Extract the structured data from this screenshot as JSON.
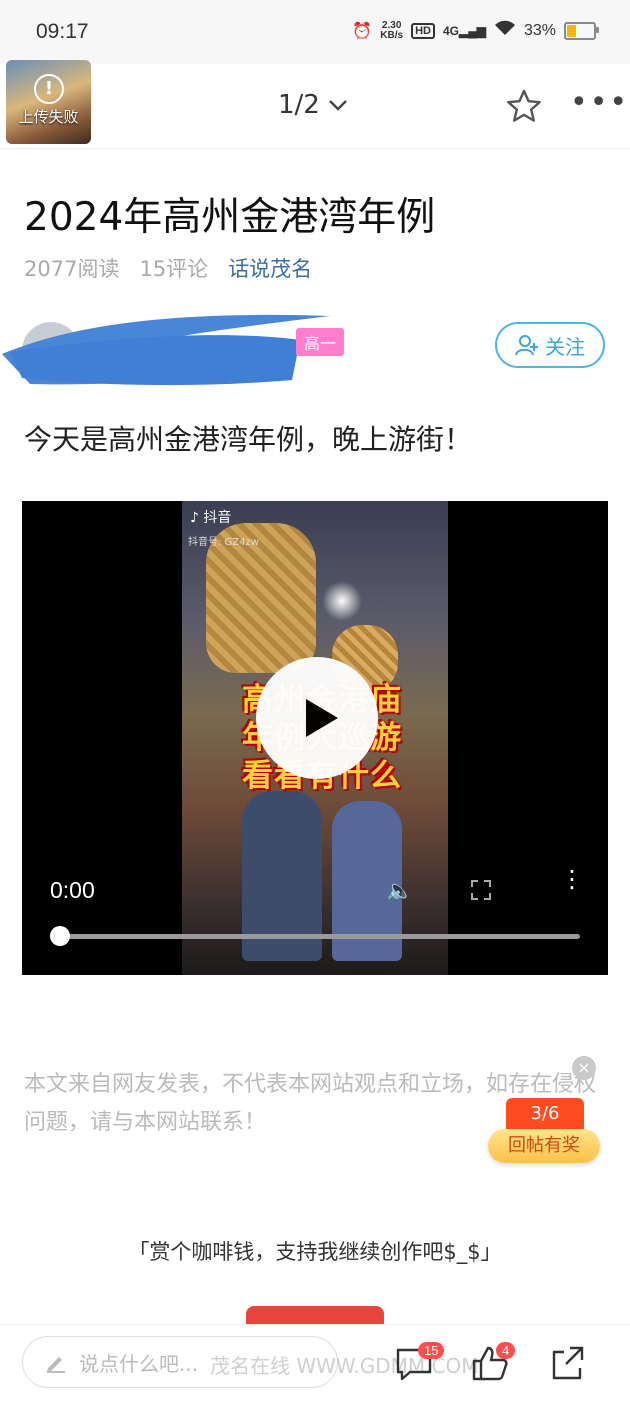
{
  "status_bar": {
    "time": "09:17",
    "net_speed_value": "2.30",
    "net_speed_unit": "KB/s",
    "hd": "HD",
    "network": "4G",
    "battery": "33%",
    "battery_level": 0.33
  },
  "header": {
    "thumbnail_label": "上传失败",
    "page_indicator": "1/2"
  },
  "article": {
    "title": "2024年高州金港湾年例",
    "reads": "2077阅读",
    "comments": "15评论",
    "source": "话说茂名",
    "author_badge": "高一",
    "follow_label": "关注",
    "content": "今天是高州金港湾年例，晚上游街！"
  },
  "video": {
    "platform": "抖音",
    "account_id": "抖音号: GZ4zw",
    "overlay_text": [
      "高州金港庙",
      "年例大巡游",
      "看看有什么"
    ],
    "time": "0:00",
    "progress": 0
  },
  "disclaimer": "本文来自网友发表，不代表本网站观点和立场，如存在侵权问题，请与本网站联系！",
  "reward_float": {
    "count": "3/6",
    "label": "回帖有奖"
  },
  "tip_text": "「赏个咖啡钱，支持我继续创作吧$_$」",
  "bottom_bar": {
    "comment_placeholder": "说点什么吧...",
    "comment_count": "15",
    "like_count": "4"
  },
  "watermark": "茂名在线 WWW.GDMM.COM",
  "colors": {
    "accent": "#3aa6dc",
    "source_link": "#3a6ea5",
    "badge": "#ff7fcf",
    "reward": "#ff4b1f"
  }
}
